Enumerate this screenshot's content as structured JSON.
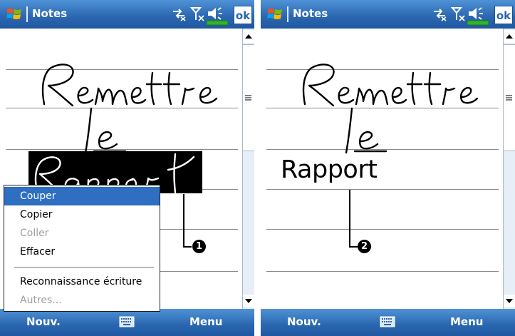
{
  "app": {
    "title": "Notes",
    "ok_label": "ok",
    "icons": [
      "windows-start-flag-icon",
      "connectivity-icon",
      "signal-off-icon",
      "speaker-icon",
      "battery-icon"
    ]
  },
  "menubar": {
    "new_label": "Nouv.",
    "menu_label": "Menu",
    "keyboard_icon": "keyboard-icon"
  },
  "left_screen": {
    "context_menu": {
      "items": [
        {
          "label": "Couper"
        },
        {
          "label": "Copier"
        },
        {
          "label": "Coller"
        },
        {
          "label": "Effacer"
        },
        {
          "label": "Reconnaissance écriture"
        },
        {
          "label": "Autres..."
        }
      ],
      "selected": "Couper",
      "disabled": [
        "Coller",
        "Autres..."
      ]
    },
    "callout": "1"
  },
  "right_screen": {
    "recognized_text": "Rapport",
    "callout": "2"
  },
  "colors": {
    "titlebar": "#2a66b0",
    "menu_highlight": "#2f6fc2",
    "battery": "#2fb52a"
  }
}
